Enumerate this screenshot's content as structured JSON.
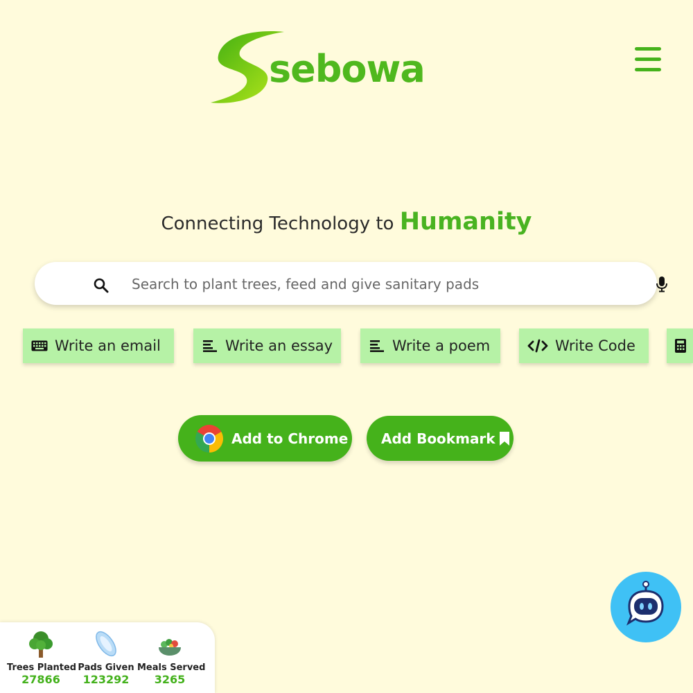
{
  "brand": {
    "name": "sebowa",
    "primary_color": "#45b21b",
    "background": "#fffbdc"
  },
  "header": {
    "menu_icon": "hamburger-menu-icon"
  },
  "hero": {
    "tagline_prefix": "Connecting Technology to",
    "tagline_highlight": "Humanity"
  },
  "search": {
    "placeholder": "Search to plant trees, feed and give sanitary pads",
    "value": "",
    "search_icon": "search-icon",
    "voice_icon": "microphone-icon"
  },
  "quick_actions": [
    {
      "label": "Write an email",
      "icon": "keyboard-icon"
    },
    {
      "label": "Write an essay",
      "icon": "align-left-icon"
    },
    {
      "label": "Write a poem",
      "icon": "align-left-icon"
    },
    {
      "label": "Write Code",
      "icon": "code-icon"
    },
    {
      "label": "",
      "icon": "calculator-icon"
    }
  ],
  "actions": {
    "add_to_chrome": "Add to Chrome",
    "add_bookmark": "Add Bookmark"
  },
  "impact": {
    "trees": {
      "label": "Trees Planted",
      "value": "27866",
      "icon": "tree-icon"
    },
    "pads": {
      "label": "Pads Given",
      "value": "123292",
      "icon": "sanitary-pad-icon"
    },
    "meals": {
      "label": "Meals Served",
      "value": "3265",
      "icon": "salad-bowl-icon"
    }
  },
  "chatbot": {
    "icon": "robot-chat-icon",
    "color": "#3fc1f5"
  }
}
